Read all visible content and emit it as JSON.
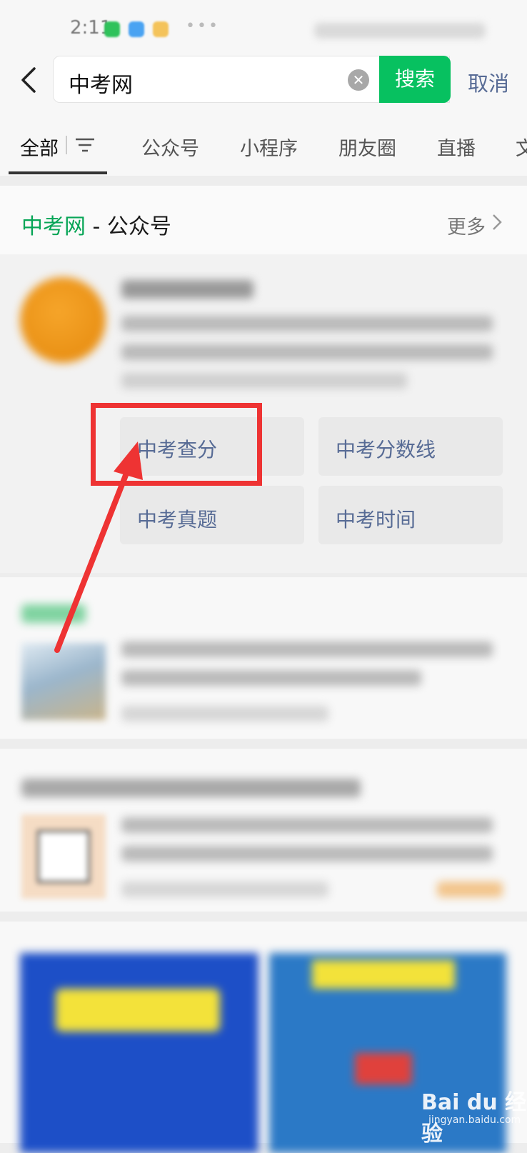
{
  "status_bar": {
    "time": "2:11"
  },
  "search": {
    "query": "中考网",
    "search_label": "搜索",
    "cancel_label": "取消"
  },
  "tabs": [
    {
      "label": "全部",
      "active": true
    },
    {
      "label": "公众号"
    },
    {
      "label": "小程序"
    },
    {
      "label": "朋友圈"
    },
    {
      "label": "直播"
    },
    {
      "label": "文"
    }
  ],
  "section": {
    "keyword": "中考网",
    "suffix": " - 公众号",
    "more_label": "更多"
  },
  "quick_links": [
    {
      "label": "中考查分"
    },
    {
      "label": "中考分数线"
    },
    {
      "label": "中考真题"
    },
    {
      "label": "中考时间"
    }
  ],
  "colors": {
    "accent": "#07c160",
    "link": "#576b95",
    "annotation": "#ee3333"
  },
  "watermark": {
    "text": "Bai du 经验",
    "sub": "jingyan.baidu.com"
  }
}
